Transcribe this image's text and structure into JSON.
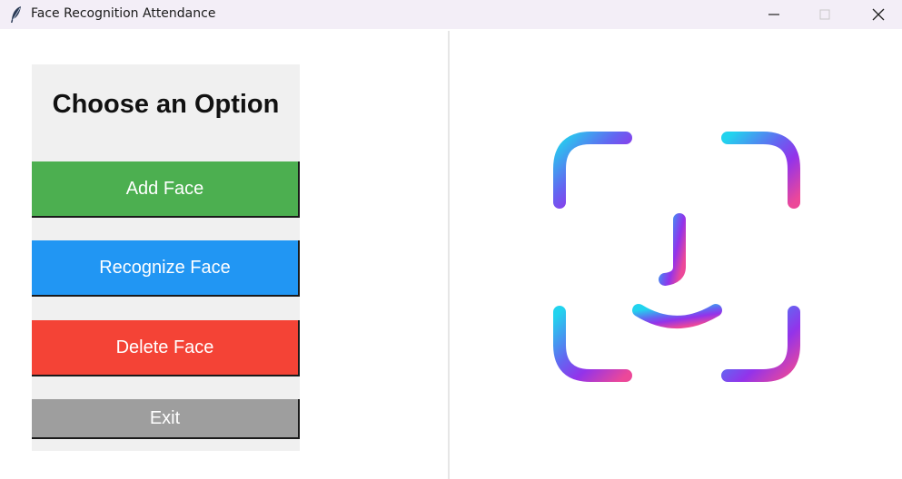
{
  "window": {
    "title": "Face Recognition Attendance",
    "controls": [
      "minimize",
      "maximize",
      "close"
    ]
  },
  "panel": {
    "title": "Choose an Option",
    "buttons": [
      {
        "label": "Add Face",
        "color": "#4caf50"
      },
      {
        "label": "Recognize Face",
        "color": "#2196f3"
      },
      {
        "label": "Delete Face",
        "color": "#f44336"
      },
      {
        "label": "Exit",
        "color": "#9e9e9e"
      }
    ]
  },
  "graphic": {
    "icon": "face-id-icon",
    "gradient": [
      "#22d3ee",
      "#6366f1",
      "#9333ea",
      "#ec4899"
    ]
  }
}
